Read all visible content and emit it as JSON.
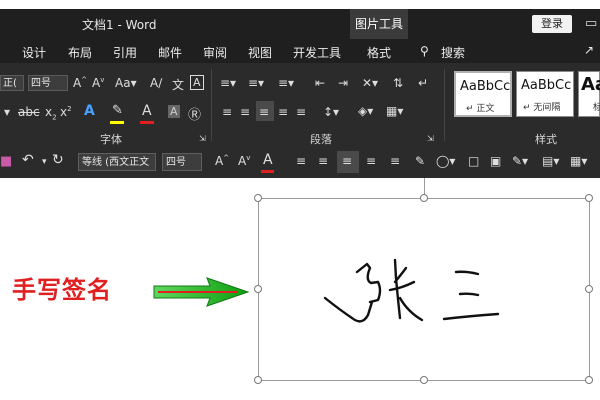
{
  "titlebar": {
    "doc_title": "文档1  -  Word",
    "context_tool": "图片工具",
    "login": "登录",
    "window_icon": "restore-icon"
  },
  "menu": {
    "items": [
      "设计",
      "布局",
      "引用",
      "邮件",
      "审阅",
      "视图",
      "开发工具",
      "格式",
      "搜索"
    ]
  },
  "ribbon": {
    "font_name_value": "正(",
    "font_size_value": "四号",
    "style_group": {
      "samples": [
        {
          "sample": "AaBbCc",
          "name": "正文"
        },
        {
          "sample": "AaBbCc",
          "name": "无间隔"
        },
        {
          "sample": "Aa",
          "name": "标"
        }
      ]
    },
    "groups": {
      "font": "字体",
      "paragraph": "段落",
      "styles": "样式"
    },
    "colors": {
      "highlight": "#ffff00",
      "font_color": "#e02020"
    }
  },
  "quick_access": {
    "font_combo": "等线 (西文正文",
    "size_combo": "四号"
  },
  "annotation": {
    "label": "手写签名",
    "arrow_color": "#18b418"
  },
  "signature": {
    "chars": [
      "张",
      "三"
    ]
  }
}
